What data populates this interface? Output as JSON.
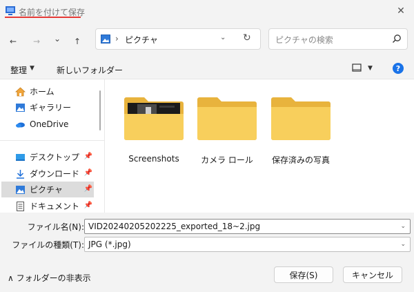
{
  "window": {
    "title": "名前を付けて保存",
    "close_glyph": "✕"
  },
  "nav": {
    "back": "←",
    "forward": "→",
    "recent": "⌄",
    "up": "↑"
  },
  "address": {
    "separator": "›",
    "location": "ピクチャ",
    "dropdown": "⌄",
    "refresh": "↻"
  },
  "search": {
    "placeholder": "ピクチャの検索"
  },
  "commandbar": {
    "organize": "整理",
    "organize_dd": "▼",
    "new_folder": "新しいフォルダー",
    "view_dd": "▼",
    "help": "?"
  },
  "sidebar": {
    "items": [
      {
        "label": "ホーム",
        "icon": "home-icon"
      },
      {
        "label": "ギャラリー",
        "icon": "gallery-icon"
      },
      {
        "label": "OneDrive",
        "icon": "cloud-icon"
      },
      {
        "label": "デスクトップ",
        "icon": "desktop-icon",
        "pin": "📌"
      },
      {
        "label": "ダウンロード",
        "icon": "download-icon",
        "pin": "📌"
      },
      {
        "label": "ピクチャ",
        "icon": "pictures-icon",
        "pin": "📌",
        "selected": true
      },
      {
        "label": "ドキュメント",
        "icon": "documents-icon",
        "pin": "📌"
      }
    ]
  },
  "folders": [
    {
      "label": "Screenshots",
      "has_thumbnail": true
    },
    {
      "label": "カメラ ロール",
      "has_thumbnail": false
    },
    {
      "label": "保存済みの写真",
      "has_thumbnail": false
    }
  ],
  "fields": {
    "filename_label": "ファイル名(N):",
    "filename_value": "VID20240205202225_exported_18~2.jpg",
    "filetype_label": "ファイルの種類(T):",
    "filetype_value": "JPG (*.jpg)",
    "dd": "⌄"
  },
  "footer": {
    "hide_folders": "フォルダーの非表示",
    "hide_glyph": "∧",
    "save": "保存(S)",
    "cancel": "キャンセル"
  },
  "colors": {
    "accent": "#1a73e8",
    "folder": "#f8cf5c",
    "folder_back": "#e8b33d",
    "title_underline": "#e53935"
  }
}
